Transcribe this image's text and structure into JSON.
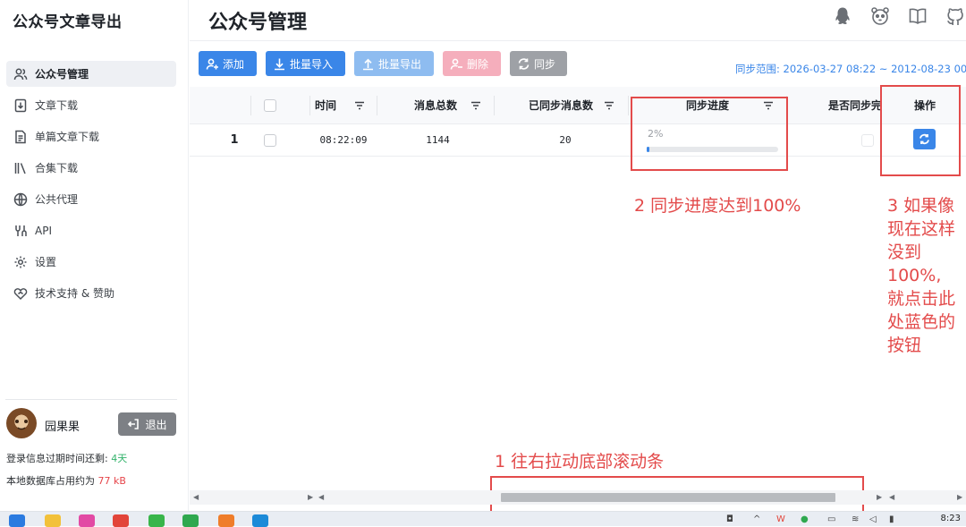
{
  "sidebar": {
    "app_title": "公众号文章导出",
    "items": [
      {
        "label": "公众号管理",
        "icon": "users-icon",
        "active": true
      },
      {
        "label": "文章下载",
        "icon": "download-doc-icon"
      },
      {
        "label": "单篇文章下载",
        "icon": "document-icon"
      },
      {
        "label": "合集下载",
        "icon": "library-icon"
      },
      {
        "label": "公共代理",
        "icon": "globe-icon"
      },
      {
        "label": "API",
        "icon": "api-icon"
      },
      {
        "label": "设置",
        "icon": "gear-icon"
      },
      {
        "label": "技术支持 & 赞助",
        "icon": "heart-handshake-icon"
      }
    ],
    "user": {
      "name": "园果果",
      "logout_label": "退出",
      "expire_label": "登录信息过期时间还剩:",
      "expire_value": "4天",
      "db_label": "本地数据库占用约为",
      "db_value": "77 kB"
    }
  },
  "header": {
    "title": "公众号管理",
    "icons": [
      "qq-icon",
      "panda-icon",
      "book-icon",
      "github-icon"
    ]
  },
  "toolbar": {
    "add": "添加",
    "import": "批量导入",
    "export": "批量导出",
    "delete": "删除",
    "sync": "同步",
    "range": "同步范围: 2026-03-27 08:22 ~ 2012-08-23 00"
  },
  "table": {
    "headers": {
      "time": "时间",
      "total": "消息总数",
      "synced": "已同步消息数",
      "progress": "同步进度",
      "is_synced": "是否同步完",
      "action": "操作"
    },
    "rows": [
      {
        "index": "1",
        "time": "08:22:09",
        "total": "1144",
        "synced": "20",
        "progress_text": "2%",
        "progress": 0.02
      }
    ]
  },
  "annotations": {
    "a1": "1 往右拉动底部滚动条",
    "a2": "2 同步进度达到100%",
    "a3": [
      "3 如果像",
      "现在这样",
      "没到",
      "100%,",
      "就点击此",
      "处蓝色的",
      "按钮"
    ]
  },
  "taskbar": {
    "clock": "8:23"
  },
  "colors": {
    "primary": "#3a86e8",
    "annotation": "#e34b4b",
    "green": "#33b36b",
    "red": "#e6454a"
  }
}
